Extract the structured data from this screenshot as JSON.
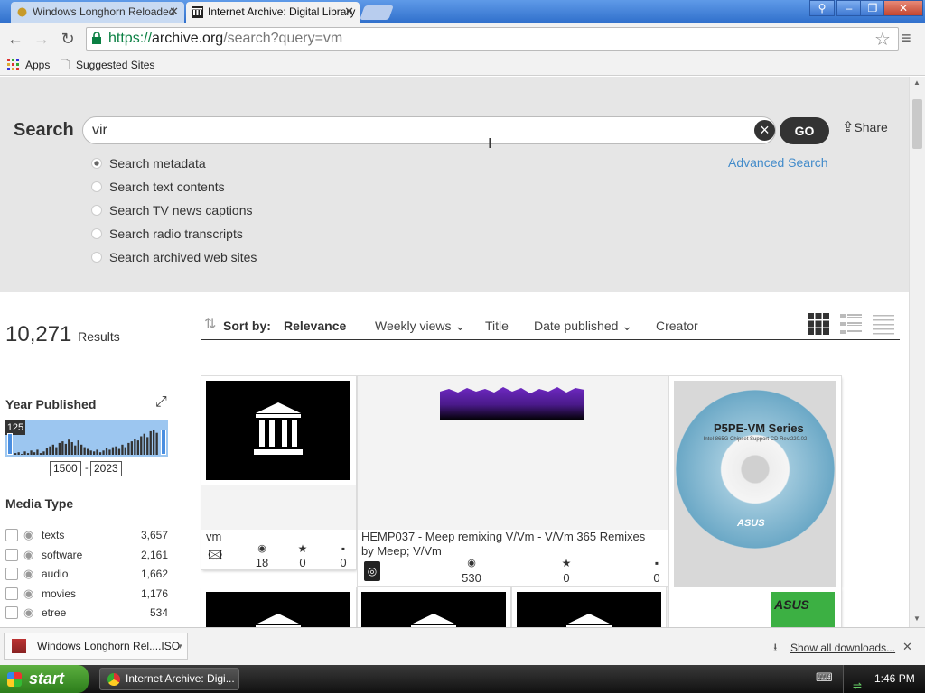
{
  "browser": {
    "tabs": [
      {
        "label": "Windows Longhorn Reloaded",
        "active": false
      },
      {
        "label": "Internet Archive: Digital Library",
        "active": true
      }
    ],
    "url_scheme": "https://",
    "url_host": "archive.org",
    "url_path": "/search?query=vm",
    "bookmarks": [
      {
        "label": "Apps",
        "icon": "apps-grid-icon"
      },
      {
        "label": "Suggested Sites",
        "icon": "page-icon"
      }
    ]
  },
  "search": {
    "label": "Search",
    "query": "vir",
    "go_label": "GO",
    "share_label": "Share",
    "advanced_label": "Advanced Search",
    "options": [
      {
        "label": "Search metadata",
        "checked": true
      },
      {
        "label": "Search text contents",
        "checked": false
      },
      {
        "label": "Search TV news captions",
        "checked": false
      },
      {
        "label": "Search radio transcripts",
        "checked": false
      },
      {
        "label": "Search archived web sites",
        "checked": false
      }
    ]
  },
  "results": {
    "count": "10,271",
    "count_label": "Results",
    "sort_by_label": "Sort by:",
    "sort_options": [
      "Relevance",
      "Weekly views",
      "Title",
      "Date published",
      "Creator"
    ]
  },
  "facets": {
    "year_title": "Year Published",
    "year_badge": "125",
    "year_from": "1500",
    "year_to": "2023",
    "histogram_bars": [
      2,
      3,
      1,
      4,
      2,
      5,
      3,
      6,
      2,
      4,
      8,
      10,
      12,
      9,
      14,
      16,
      13,
      18,
      15,
      11,
      17,
      12,
      9,
      7,
      5,
      4,
      6,
      3,
      5,
      8,
      6,
      9,
      10,
      7,
      12,
      9,
      14,
      16,
      19,
      17,
      22,
      25,
      21,
      28,
      30,
      26
    ],
    "media_title": "Media Type",
    "media": [
      {
        "label": "texts",
        "count": "3,657"
      },
      {
        "label": "software",
        "count": "2,161"
      },
      {
        "label": "audio",
        "count": "1,662"
      },
      {
        "label": "movies",
        "count": "1,176"
      },
      {
        "label": "etree",
        "count": "534"
      }
    ]
  },
  "cards": [
    {
      "title": "vm",
      "views": "18",
      "favs": "0",
      "reviews": "0",
      "type_icon": "image-icon"
    },
    {
      "title": "HEMP037 - Meep remixing V/Vm - V/Vm 365 Remixes",
      "creator": "by Meep; V/Vm",
      "views": "530",
      "favs": "0",
      "reviews": "0",
      "type_icon": "audio-icon"
    },
    {
      "title": "P5PE-VM Series",
      "image_text": "P5PE-VM Series",
      "image_sub": "Intel 865G Chipset Support CD Rev.220.02",
      "brand": "ASUS"
    }
  ],
  "downloads": {
    "item_label": "Windows Longhorn Rel....ISO",
    "show_all": "Show all downloads..."
  },
  "taskbar": {
    "start_label": "start",
    "task_label": "Internet Archive: Digi...",
    "clock": "1:46 PM"
  },
  "colors": {
    "accent_link": "#428bca",
    "search_panel": "#e6e6e6",
    "histogram": "#9cc6f0",
    "histogram_bar": "#333333",
    "purple_waveform": "#6a1fb5",
    "taskbar_start": "#3d9a2a"
  }
}
